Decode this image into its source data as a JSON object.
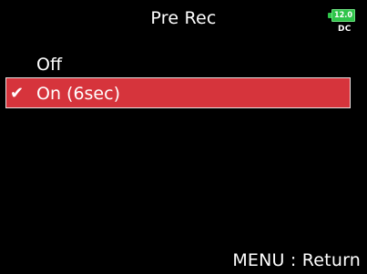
{
  "header": {
    "title": "Pre Rec"
  },
  "status": {
    "battery_voltage": "12.0",
    "power_source": "DC",
    "battery_color": "#2fc44a"
  },
  "menu": {
    "items": [
      {
        "label": "Off",
        "selected": false
      },
      {
        "label": "On (6sec)",
        "selected": true,
        "check_icon": "checkmark-icon"
      }
    ],
    "highlight_color": "#d6343c"
  },
  "footer": {
    "hint": "MENU : Return"
  }
}
